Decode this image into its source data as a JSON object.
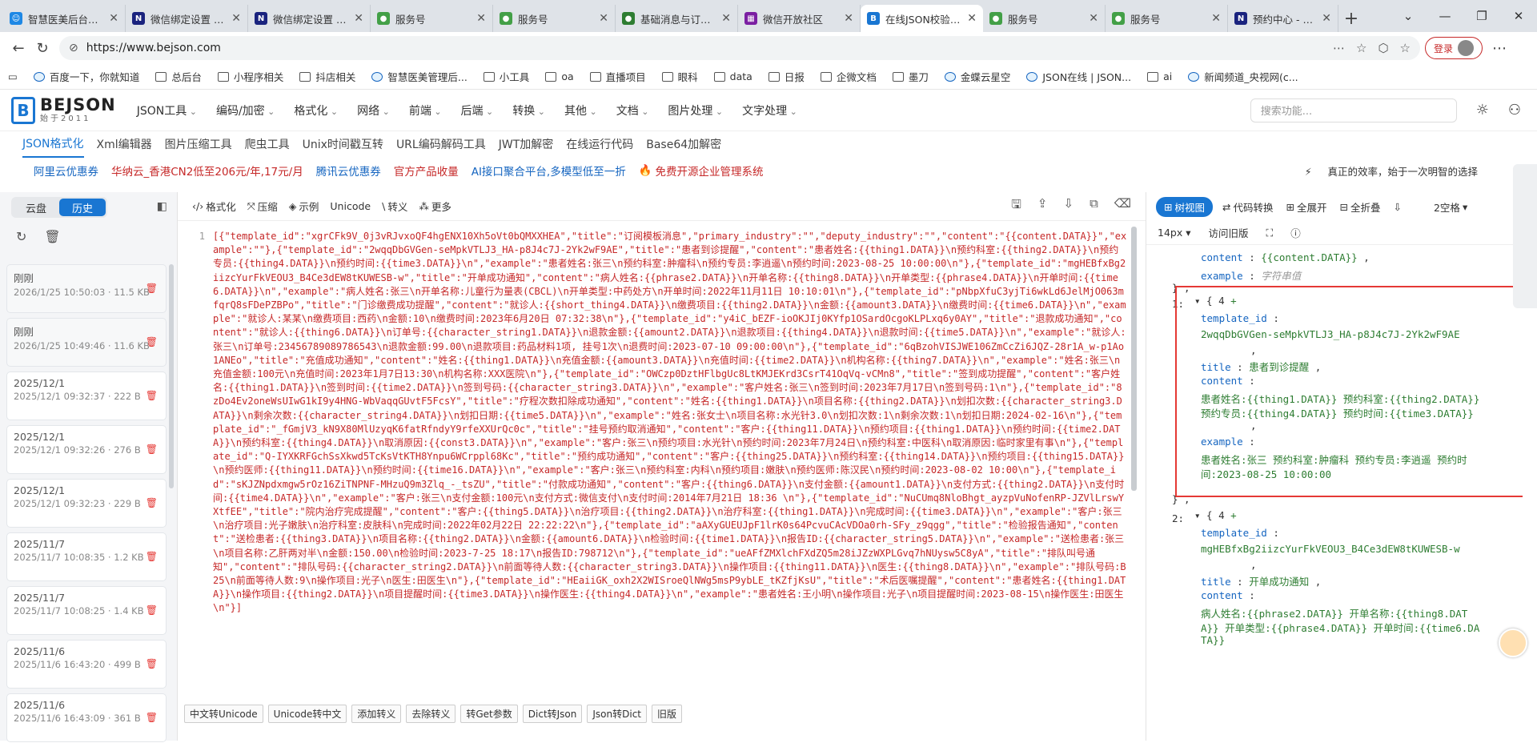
{
  "browser": {
    "tabs": [
      {
        "title": "智慧医美后台管理",
        "color": "#1e88e5",
        "glyph": "☺"
      },
      {
        "title": "微信绑定设置 - 内部",
        "color": "#1a237e",
        "glyph": "N"
      },
      {
        "title": "微信绑定设置 - 测试",
        "color": "#1a237e",
        "glyph": "N"
      },
      {
        "title": "服务号",
        "color": "#43a047",
        "glyph": "●"
      },
      {
        "title": "服务号",
        "color": "#43a047",
        "glyph": "●"
      },
      {
        "title": "基础消息与订阅通知",
        "color": "#2e7d32",
        "glyph": "●"
      },
      {
        "title": "微信开放社区",
        "color": "#7b1fa2",
        "glyph": "▦"
      },
      {
        "title": "在线JSON校验格式化",
        "color": "#1976d2",
        "glyph": "B"
      },
      {
        "title": "服务号",
        "color": "#43a047",
        "glyph": "●"
      },
      {
        "title": "服务号",
        "color": "#43a047",
        "glyph": "●"
      },
      {
        "title": "预约中心 - 内部帆",
        "color": "#1a237e",
        "glyph": "N"
      }
    ],
    "active_tab": 7,
    "url": "https://www.bejson.com",
    "login_label": "登录",
    "bookmarks": [
      "百度一下，你就知道",
      "总后台",
      "小程序相关",
      "抖店相关",
      "智慧医美管理后...",
      "小工具",
      "oa",
      "直播项目",
      "眼科",
      "data",
      "日报",
      "企微文档",
      "墨刀",
      "金蝶云星空",
      "JSON在线 | JSON...",
      "ai",
      "新闻频道_央视网(c..."
    ]
  },
  "site": {
    "logo_name": "BEJSON",
    "logo_sub": "始于2011",
    "menu": [
      "JSON工具",
      "编码/加密",
      "格式化",
      "网络",
      "前端",
      "后端",
      "转换",
      "其他",
      "文档",
      "图片处理",
      "文字处理"
    ],
    "search_placeholder": "搜索功能...",
    "subnav": [
      "JSON格式化",
      "Xml编辑器",
      "图片压缩工具",
      "爬虫工具",
      "Unix时间戳互转",
      "URL编码解码工具",
      "JWT加解密",
      "在线运行代码",
      "Base64加解密"
    ],
    "ads": [
      {
        "text": "阿里云优惠券",
        "color": "#1565c0"
      },
      {
        "text": "华纳云_香港CN2低至206元/年,17元/月",
        "color": "#c62828"
      },
      {
        "text": "腾讯云优惠券",
        "color": "#1565c0"
      },
      {
        "text": "官方产品收量",
        "color": "#c62828"
      },
      {
        "text": "AI接口聚合平台,多模型低至一折",
        "color": "#1565c0"
      },
      {
        "text": "免费开源企业管理系统",
        "color": "#c62828"
      }
    ],
    "slogan": "真正的效率，始于一次明智的选择"
  },
  "sidebar": {
    "cloud_label": "云盘",
    "history_label": "历史",
    "items": [
      {
        "date": "刚刚",
        "meta": "2026/1/25 10:50:03 · 11.5 KB"
      },
      {
        "date": "刚刚",
        "meta": "2026/1/25 10:49:46 · 11.6 KB"
      },
      {
        "date": "2025/12/1",
        "meta": "2025/12/1 09:32:37 · 222 B"
      },
      {
        "date": "2025/12/1",
        "meta": "2025/12/1 09:32:26 · 276 B"
      },
      {
        "date": "2025/12/1",
        "meta": "2025/12/1 09:32:23 · 229 B"
      },
      {
        "date": "2025/11/7",
        "meta": "2025/11/7 10:08:35 · 1.2 KB"
      },
      {
        "date": "2025/11/7",
        "meta": "2025/11/7 10:08:25 · 1.4 KB"
      },
      {
        "date": "2025/11/6",
        "meta": "2025/11/6 16:43:20 · 499 B"
      },
      {
        "date": "2025/11/6",
        "meta": "2025/11/6 16:43:09 · 361 B"
      }
    ]
  },
  "editor": {
    "toolbar": [
      "格式化",
      "压缩",
      "示例",
      "Unicode",
      "转义",
      "更多"
    ],
    "line_number": "1",
    "content": "[{\"template_id\":\"xgrCFk9V_0j3vRJvxoQF4hgENX10Xh5oVt0bQMXXHEA\",\"title\":\"订阅模板消息\",\"primary_industry\":\"\",\"deputy_industry\":\"\",\"content\":\"{{content.DATA}}\",\"example\":\"\"},{\"template_id\":\"2wqqDbGVGen-seMpkVTLJ3_HA-p8J4c7J-2Yk2wF9AE\",\"title\":\"患者到诊提醒\",\"content\":\"患者姓名:{{thing1.DATA}}\\n预约科室:{{thing2.DATA}}\\n预约专员:{{thing4.DATA}}\\n预约时间:{{time3.DATA}}\\n\",\"example\":\"患者姓名:张三\\n预约科室:肿瘤科\\n预约专员:李逍遥\\n预约时间:2023-08-25 10:00:00\\n\"},{\"template_id\":\"mgHEBfxBg2iizcYurFkVEOU3_B4Ce3dEW8tKUWESB-w\",\"title\":\"开单成功通知\",\"content\":\"病人姓名:{{phrase2.DATA}}\\n开单名称:{{thing8.DATA}}\\n开单类型:{{phrase4.DATA}}\\n开单时间:{{time6.DATA}}\\n\",\"example\":\"病人姓名:张三\\n开单名称:儿童行为量表(CBCL)\\n开单类型:中药处方\\n开单时间:2022年11月11日 10:10:01\\n\"},{\"template_id\":\"pNbpXfuC3yjTi6wkLd6JelMjO063mfqrQ8sFDePZBPo\",\"title\":\"门诊缴费成功提醒\",\"content\":\"就诊人:{{short_thing4.DATA}}\\n缴费项目:{{thing2.DATA}}\\n金额:{{amount3.DATA}}\\n缴费时间:{{time6.DATA}}\\n\",\"example\":\"就诊人:某某\\n缴费项目:西药\\n金额:10\\n缴费时间:2023年6月20日 07:32:38\\n\"},{\"template_id\":\"y4iC_bEZF-ioOKJIj0KYfp1OSardOcgoKLPLxq6y0AY\",\"title\":\"退款成功通知\",\"content\":\"就诊人:{{thing6.DATA}}\\n订单号:{{character_string1.DATA}}\\n退款金额:{{amount2.DATA}}\\n退款项目:{{thing4.DATA}}\\n退款时间:{{time5.DATA}}\\n\",\"example\":\"就诊人:张三\\n订单号:23456789089786543\\n退款金额:99.00\\n退款项目:药品材料1项, 挂号1次\\n退费时间:2023-07-10 09:00:00\\n\"},{\"template_id\":\"6qBzohVISJWE106ZmCcZi6JQZ-28r1A_w-p1Ao1ANEo\",\"title\":\"充值成功通知\",\"content\":\"姓名:{{thing1.DATA}}\\n充值金额:{{amount3.DATA}}\\n充值时间:{{time2.DATA}}\\n机构名称:{{thing7.DATA}}\\n\",\"example\":\"姓名:张三\\n充值金额:100元\\n充值时间:2023年1月7日13:30\\n机构名称:XXX医院\\n\"},{\"template_id\":\"OWCzp0DztHFlbgUc8LtKMJEKrd3CsrT41OqVq-vCMn8\",\"title\":\"签到成功提醒\",\"content\":\"客户姓名:{{thing1.DATA}}\\n签到时间:{{time2.DATA}}\\n签到号码:{{character_string3.DATA}}\\n\",\"example\":\"客户姓名:张三\\n签到时间:2023年7月17日\\n签到号码:1\\n\"},{\"template_id\":\"8zDo4Ev2oneWsUIwG1kI9y4HNG-WbVaqqGUvtF5FcsY\",\"title\":\"疗程次数扣除成功通知\",\"content\":\"姓名:{{thing1.DATA}}\\n项目名称:{{thing2.DATA}}\\n划扣次数:{{character_string3.DATA}}\\n剩余次数:{{character_string4.DATA}}\\n划扣日期:{{time5.DATA}}\\n\",\"example\":\"姓名:张女士\\n项目名称:水光针3.0\\n划扣次数:1\\n剩余次数:1\\n划扣日期:2024-02-16\\n\"},{\"template_id\":\"_fGmjV3_kN9X80MlUzyqK6fatRfndyY9rfeXXUrQc0c\",\"title\":\"挂号预约取消通知\",\"content\":\"客户:{{thing11.DATA}}\\n预约项目:{{thing1.DATA}}\\n预约时间:{{time2.DATA}}\\n预约科室:{{thing4.DATA}}\\n取消原因:{{const3.DATA}}\\n\",\"example\":\"客户:张三\\n预约项目:水光针\\n预约时间:2023年7月24日\\n预约科室:中医科\\n取消原因:临时家里有事\\n\"},{\"template_id\":\"Q-IYXKRFGchSsXkwd5TcKsVtKTH8Ynpu6WCrppl68Kc\",\"title\":\"预约成功通知\",\"content\":\"客户:{{thing25.DATA}}\\n预约科室:{{thing14.DATA}}\\n预约项目:{{thing15.DATA}}\\n预约医师:{{thing11.DATA}}\\n预约时间:{{time16.DATA}}\\n\",\"example\":\"客户:张三\\n预约科室:内科\\n预约项目:嫩肤\\n预约医师:陈汉民\\n预约时间:2023-08-02 10:00\\n\"},{\"template_id\":\"sKJZNpdxmgw5rOz16ZiTNPNF-MHzuQ9m3Zlq_-_tsZU\",\"title\":\"付款成功通知\",\"content\":\"客户:{{thing6.DATA}}\\n支付金额:{{amount1.DATA}}\\n支付方式:{{thing2.DATA}}\\n支付时间:{{time4.DATA}}\\n\",\"example\":\"客户:张三\\n支付金额:100元\\n支付方式:微信支付\\n支付时间:2014年7月21日 18:36 \\n\"},{\"template_id\":\"NuCUmq8NloBhgt_ayzpVuNofenRP-JZVlLrswYXtfEE\",\"title\":\"院内治疗完成提醒\",\"content\":\"客户:{{thing5.DATA}}\\n治疗项目:{{thing2.DATA}}\\n治疗科室:{{thing1.DATA}}\\n完成时间:{{time3.DATA}}\\n\",\"example\":\"客户:张三\\n治疗项目:光子嫩肤\\n治疗科室:皮肤科\\n完成时间:2022年02月22日 22:22:22\\n\"},{\"template_id\":\"aAXyGUEUJpF1lrK0s64PcvuCAcVDOa0rh-SFy_z9qgg\",\"title\":\"检验报告通知\",\"content\":\"送检患者:{{thing3.DATA}}\\n项目名称:{{thing2.DATA}}\\n金额:{{amount6.DATA}}\\n检验时间:{{time1.DATA}}\\n报告ID:{{character_string5.DATA}}\\n\",\"example\":\"送检患者:张三\\n项目名称:乙肝两对半\\n金额:150.00\\n检验时间:2023-7-25 18:17\\n报告ID:798712\\n\"},{\"template_id\":\"ueAFfZMXlchFXdZQ5m28iJZzWXPLGvq7hNUysw5C8yA\",\"title\":\"排队叫号通知\",\"content\":\"排队号码:{{character_string2.DATA}}\\n前面等待人数:{{character_string3.DATA}}\\n操作项目:{{thing11.DATA}}\\n医生:{{thing8.DATA}}\\n\",\"example\":\"排队号码:B25\\n前面等待人数:9\\n操作项目:光子\\n医生:田医生\\n\"},{\"template_id\":\"HEaiiGK_oxh2X2WISroeQlNWg5msP9ybLE_tKZfjKsU\",\"title\":\"术后医嘱提醒\",\"content\":\"患者姓名:{{thing1.DATA}}\\n操作项目:{{thing2.DATA}}\\n项目提醒时间:{{time3.DATA}}\\n操作医生:{{thing4.DATA}}\\n\",\"example\":\"患者姓名:王小明\\n操作项目:光子\\n项目提醒时间:2023-08-15\\n操作医生:田医生\\n\"}]",
    "bottom_buttons": [
      "中文转Unicode",
      "Unicode转中文",
      "添加转义",
      "去除转义",
      "转Get参数",
      "Dict转Json",
      "Json转Dict",
      "旧版"
    ]
  },
  "tree": {
    "toolbar": [
      "树视图",
      "代码转换",
      "全展开",
      "全折叠"
    ],
    "indent_label": "2空格",
    "font_size": "14px",
    "old_label": "访问旧版",
    "prev_item": {
      "content_key": "content",
      "content_val": "{{content.DATA}}",
      "example_key": "example",
      "example_val": "字符串值"
    },
    "item1": {
      "index": "1:",
      "count": "4",
      "template_id": "2wqqDbGVGen-seMpkVTLJ3_HA-p8J4c7J-2Yk2wF9AE",
      "title": "患者到诊提醒",
      "content_1": "患者姓名:{{thing1.DATA}} 预约科室:{{thing2.DATA}}",
      "content_2": "预约专员:{{thing4.DATA}} 预约时间:{{time3.DATA}}",
      "example_1": "患者姓名:张三 预约科室:肿瘤科 预约专员:李逍遥 预约时",
      "example_2": "间:2023-08-25 10:00:00"
    },
    "item2": {
      "index": "2:",
      "count": "4",
      "template_id": "mgHEBfxBg2iizcYurFkVEOU3_B4Ce3dEW8tKUWESB-w",
      "title": "开单成功通知",
      "content_1": "病人姓名:{{phrase2.DATA}} 开单名称:{{thing8.DAT",
      "content_2": "A}} 开单类型:{{phrase4.DATA}} 开单时间:{{time6.DA",
      "content_3": "TA}}"
    }
  }
}
